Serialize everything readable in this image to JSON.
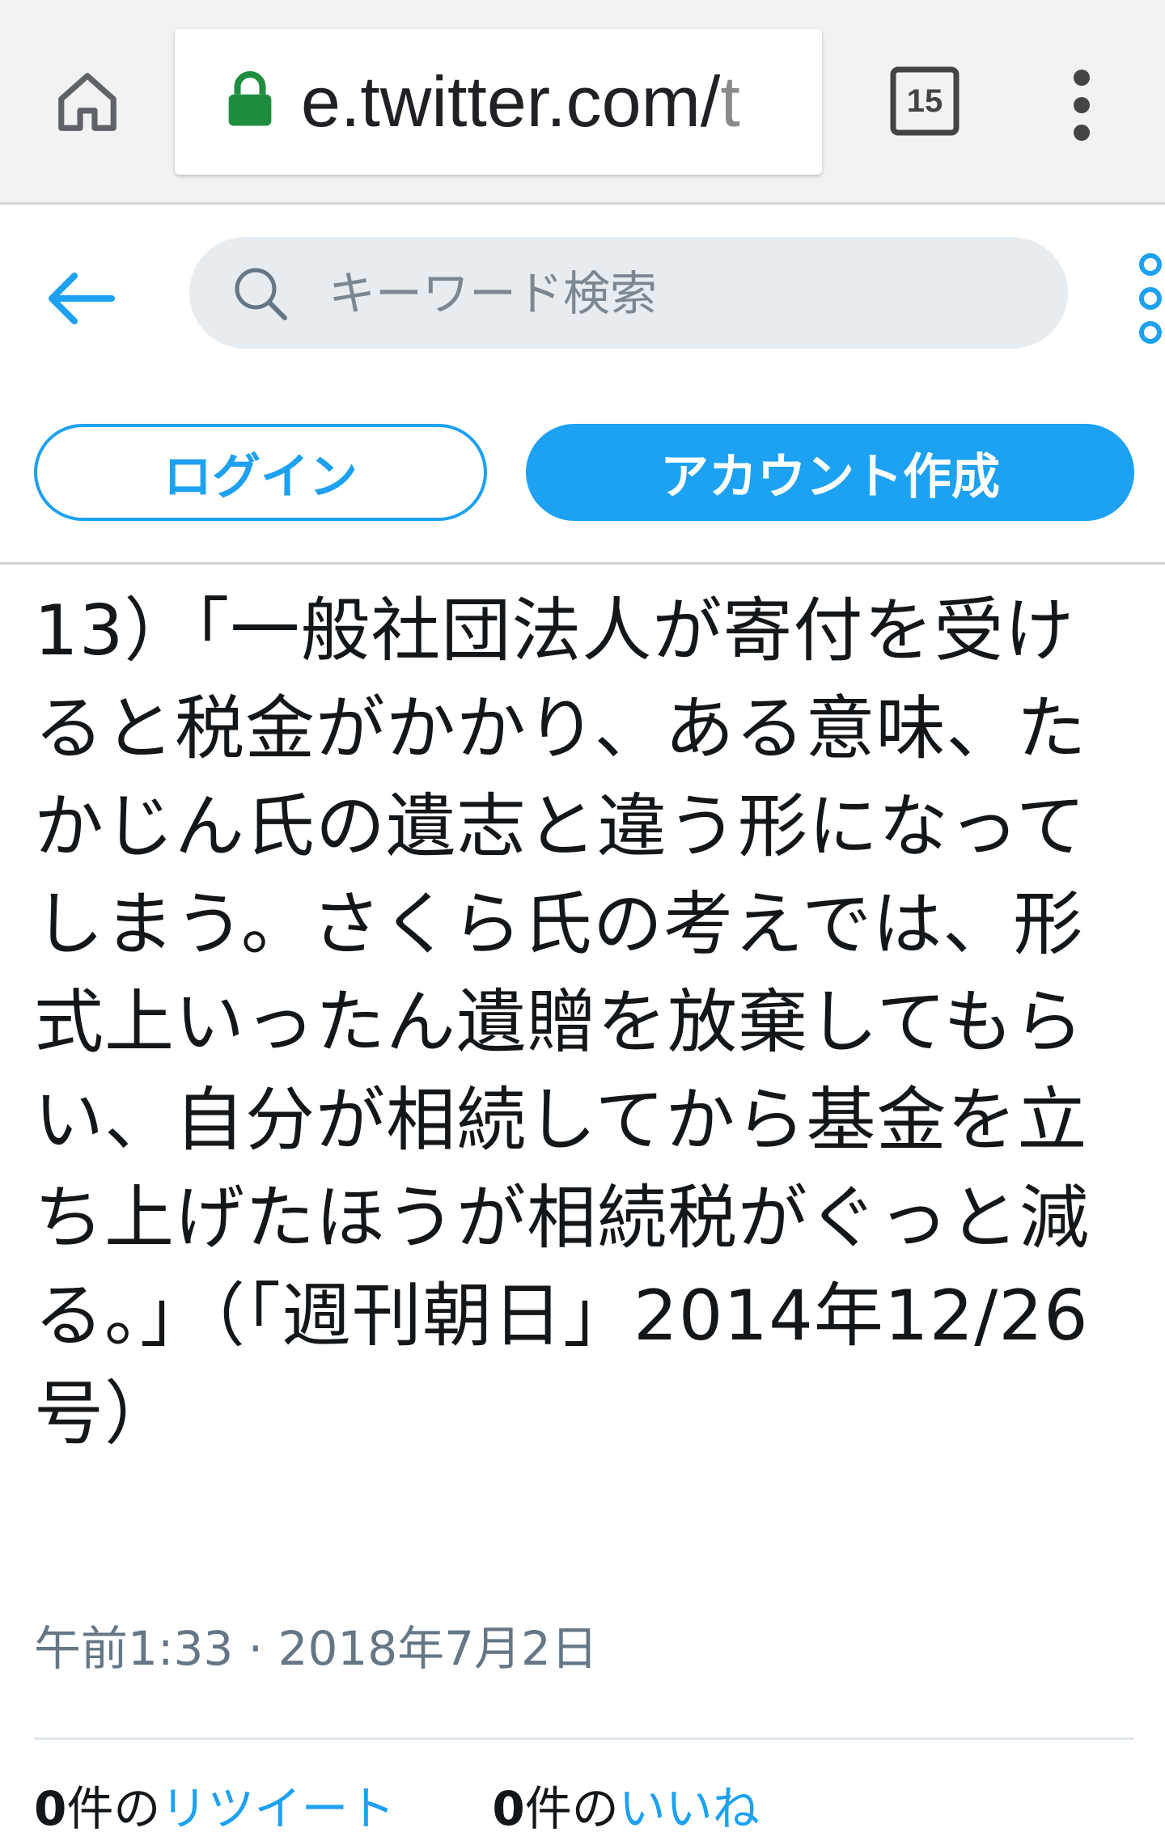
{
  "browser": {
    "url_main": "e.twitter.com/",
    "url_dim": "t",
    "tab_count": "15",
    "icons": [
      "home-icon",
      "lock-icon",
      "tabs-icon",
      "menu-dots-icon"
    ],
    "lock_color": "#1e8e3e"
  },
  "header": {
    "search_placeholder": "キーワード検索",
    "login_label": "ログイン",
    "signup_label": "アカウント作成",
    "accent_color": "#1da1f2"
  },
  "tweet": {
    "text": "13）「一般社団法人が寄付を受けると税金がかかり、ある意味、たかじん氏の遺志と違う形になってしまう。さくら氏の考えでは、形式上いったん遺贈を放棄してもらい、自分が相続してから基金を立ち上げたほうが相続税がぐっと減る。」（「週刊朝日」2014年12/26号）",
    "timestamp": "午前1:33 · 2018年7月2日",
    "retweet_count": "0",
    "retweet_suffix": "件の",
    "retweet_label": "リツイート",
    "like_count": "0",
    "like_suffix": "件の",
    "like_label": "いいね"
  }
}
